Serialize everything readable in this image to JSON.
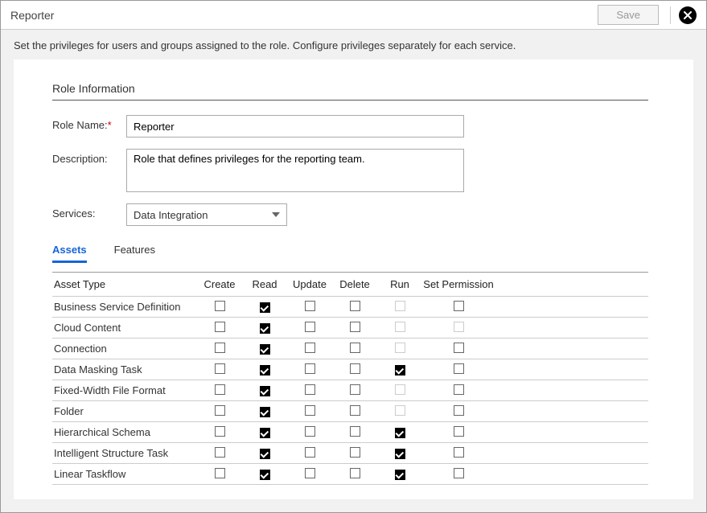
{
  "window": {
    "title": "Reporter",
    "save_label": "Save"
  },
  "instruction": "Set the privileges for users and groups assigned to the role. Configure privileges separately for each service.",
  "section": {
    "title": "Role Information"
  },
  "form": {
    "role_name_label": "Role Name:",
    "role_name_value": "Reporter",
    "description_label": "Description:",
    "description_value": "Role that defines privileges for the reporting team.",
    "services_label": "Services:",
    "services_value": "Data Integration"
  },
  "tabs": {
    "assets": "Assets",
    "features": "Features",
    "active": "assets"
  },
  "grid": {
    "columns": {
      "asset_type": "Asset Type",
      "create": "Create",
      "read": "Read",
      "update": "Update",
      "delete": "Delete",
      "run": "Run",
      "set_permission": "Set Permission"
    },
    "rows": [
      {
        "type": "Business Service Definition",
        "create": false,
        "read": true,
        "update": false,
        "delete": false,
        "run": false,
        "run_disabled": true,
        "perm": false
      },
      {
        "type": "Cloud Content",
        "create": false,
        "read": true,
        "update": false,
        "delete": false,
        "run": false,
        "run_disabled": true,
        "perm": false,
        "perm_disabled": true
      },
      {
        "type": "Connection",
        "create": false,
        "read": true,
        "update": false,
        "delete": false,
        "run": false,
        "run_disabled": true,
        "perm": false
      },
      {
        "type": "Data Masking Task",
        "create": false,
        "read": true,
        "update": false,
        "delete": false,
        "run": true,
        "run_disabled": false,
        "perm": false
      },
      {
        "type": "Fixed-Width File Format",
        "create": false,
        "read": true,
        "update": false,
        "delete": false,
        "run": false,
        "run_disabled": true,
        "perm": false
      },
      {
        "type": "Folder",
        "create": false,
        "read": true,
        "update": false,
        "delete": false,
        "run": false,
        "run_disabled": true,
        "perm": false
      },
      {
        "type": "Hierarchical Schema",
        "create": false,
        "read": true,
        "update": false,
        "delete": false,
        "run": true,
        "run_disabled": false,
        "perm": false
      },
      {
        "type": "Intelligent Structure Task",
        "create": false,
        "read": true,
        "update": false,
        "delete": false,
        "run": true,
        "run_disabled": false,
        "perm": false
      },
      {
        "type": "Linear Taskflow",
        "create": false,
        "read": true,
        "update": false,
        "delete": false,
        "run": true,
        "run_disabled": false,
        "perm": false
      }
    ]
  }
}
